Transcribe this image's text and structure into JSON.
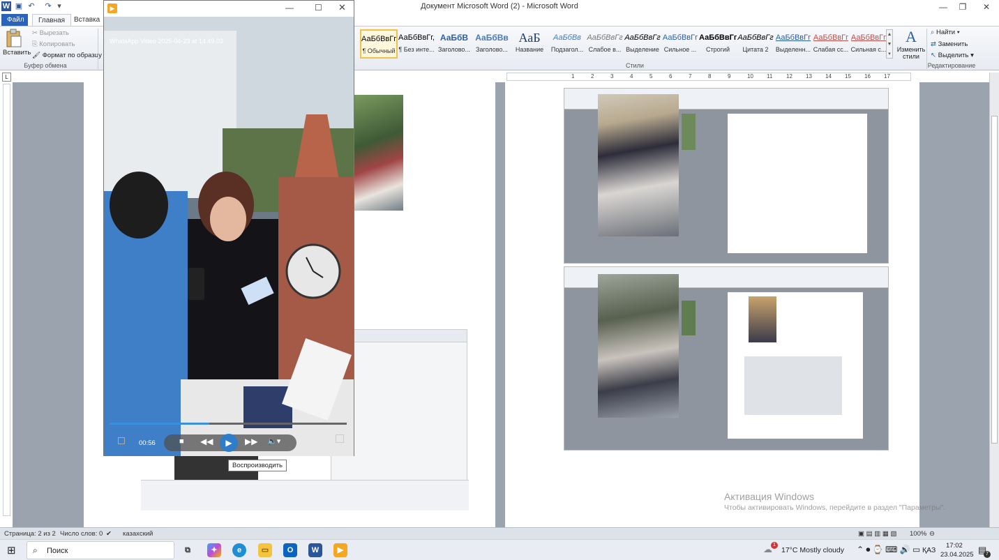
{
  "window": {
    "title": "Документ Microsoft Word (2)  -  Microsoft Word",
    "controls": {
      "minimize": "—",
      "maximize": "❐",
      "close": "✕"
    }
  },
  "ribbon_tabs": [
    "Файл",
    "Главная",
    "Вставка"
  ],
  "clipboard": {
    "paste": "Вставить",
    "cut": "Вырезать",
    "copy": "Копировать",
    "format_painter": "Формат по образцу",
    "group_label": "Буфер обмена"
  },
  "styles": {
    "items": [
      {
        "sample": "АаБбВвГг,",
        "name": "¶ Обычный",
        "color": "#000000"
      },
      {
        "sample": "АаБбВвГг,",
        "name": "¶ Без инте...",
        "color": "#000000"
      },
      {
        "sample": "АаБбВ",
        "name": "Заголово...",
        "color": "#2a5fa7"
      },
      {
        "sample": "АаБбВв",
        "name": "Заголово...",
        "color": "#4a79b8"
      },
      {
        "sample": "АаБ",
        "name": "Название",
        "color": "#1d3c6e"
      },
      {
        "sample": "АаБбВв",
        "name": "Подзагол...",
        "color": "#4a79b8"
      },
      {
        "sample": "АаБбВвГг",
        "name": "Слабое в...",
        "color": "#777777"
      },
      {
        "sample": "АаБбВвГг",
        "name": "Выделение",
        "color": "#000000"
      },
      {
        "sample": "АаБбВвГг",
        "name": "Сильное ...",
        "color": "#2a5fa7"
      },
      {
        "sample": "АаБбВвГг,",
        "name": "Строгий",
        "color": "#000000"
      },
      {
        "sample": "АаБбВвГг",
        "name": "Цитата 2",
        "color": "#000000"
      },
      {
        "sample": "АаБбВвГг",
        "name": "Выделенн...",
        "color": "#2a5fa7"
      },
      {
        "sample": "АаБбВвГг",
        "name": "Слабая сс...",
        "color": "#c0504d"
      },
      {
        "sample": "АаБбВвГг",
        "name": "Сильная с...",
        "color": "#c0504d"
      }
    ],
    "group_label": "Стили",
    "change_styles": "Изменить стили"
  },
  "editing": {
    "find": "Найти",
    "replace": "Заменить",
    "select": "Выделить",
    "group_label": "Редактирование"
  },
  "ruler_numbers": [
    "1",
    "2",
    "3",
    "4",
    "5",
    "6",
    "7",
    "8",
    "9",
    "10",
    "11",
    "12",
    "13",
    "14",
    "15",
    "16",
    "17"
  ],
  "player": {
    "title": "WhatsApp Video 2025-04-23 at 14.49.03",
    "time": "00:56",
    "progress": 0.42,
    "tooltip": "Воспроизводить"
  },
  "watermark": {
    "line1": "Активация Windows",
    "line2": "Чтобы активировать Windows, перейдите в раздел \"Параметры\"."
  },
  "statusbar": {
    "page": "Страница: 2 из 2",
    "words": "Число слов: 0",
    "language": "казахский",
    "zoom": "100%"
  },
  "taskbar": {
    "search": "Поиск",
    "weather": "17°C  Mostly cloudy",
    "lang": "ҚАЗ",
    "time": "17:02",
    "date": "23.04.2025",
    "notif_count": "7",
    "weather_badge": "1"
  }
}
